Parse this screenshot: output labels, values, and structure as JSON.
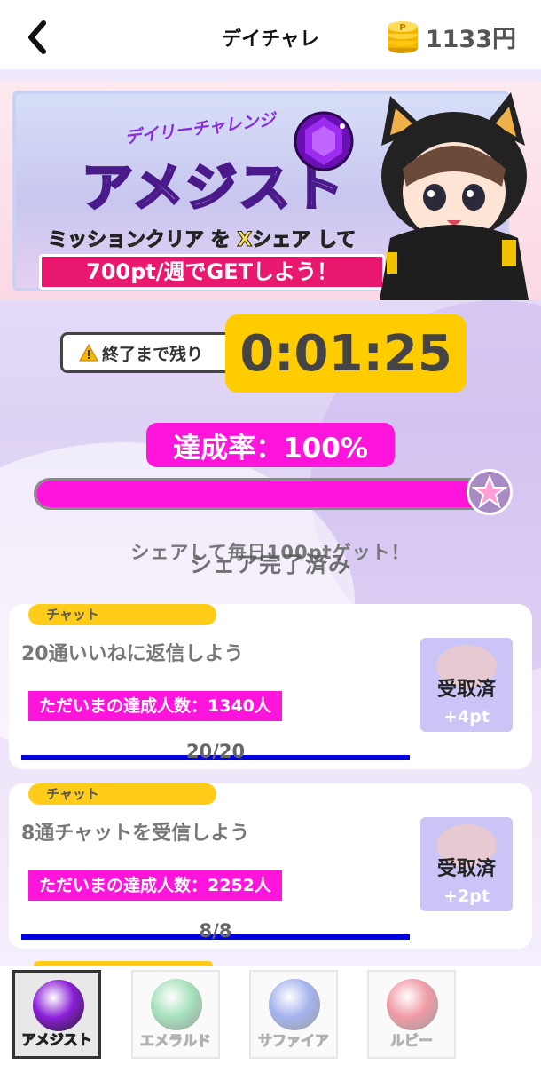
{
  "header": {
    "title": "デイチャレ",
    "coins": "1133円"
  },
  "banner": {
    "subtitle": "デイリーチャレンジ",
    "main": "アメジスト",
    "line1": "ミッションクリア を Xシェア して",
    "line2": "700pt/週でGETしよう！"
  },
  "timer": {
    "label": "終了まで残り",
    "value": "0:01:25"
  },
  "achievement": {
    "label": "達成率：100%",
    "progress_fraction": 1.0
  },
  "share": {
    "message": "シェアして毎日100ptゲット！",
    "done": "シェア完了済み"
  },
  "missions": [
    {
      "category": "チャット",
      "title": "20通いいねに返信しよう",
      "achievers": "ただいまの達成人数：1340人",
      "progress": "20/20",
      "claim_label": "受取済",
      "points": "+4pt"
    },
    {
      "category": "チャット",
      "title": "8通チャットを受信しよう",
      "achievers": "ただいまの達成人数：2252人",
      "progress": "8/8",
      "claim_label": "受取済",
      "points": "+2pt"
    }
  ],
  "tabs": [
    {
      "label": "アメジスト",
      "color": "#8b1fd6",
      "active": true
    },
    {
      "label": "エメラルド",
      "color": "#3cbf6e",
      "active": false
    },
    {
      "label": "サファイア",
      "color": "#3b5bdb",
      "active": false
    },
    {
      "label": "ルビー",
      "color": "#e0243c",
      "active": false
    }
  ],
  "colors": {
    "accent": "#ff14dc",
    "timer_bg": "#ffcc00",
    "progress_line": "#0000e0"
  }
}
